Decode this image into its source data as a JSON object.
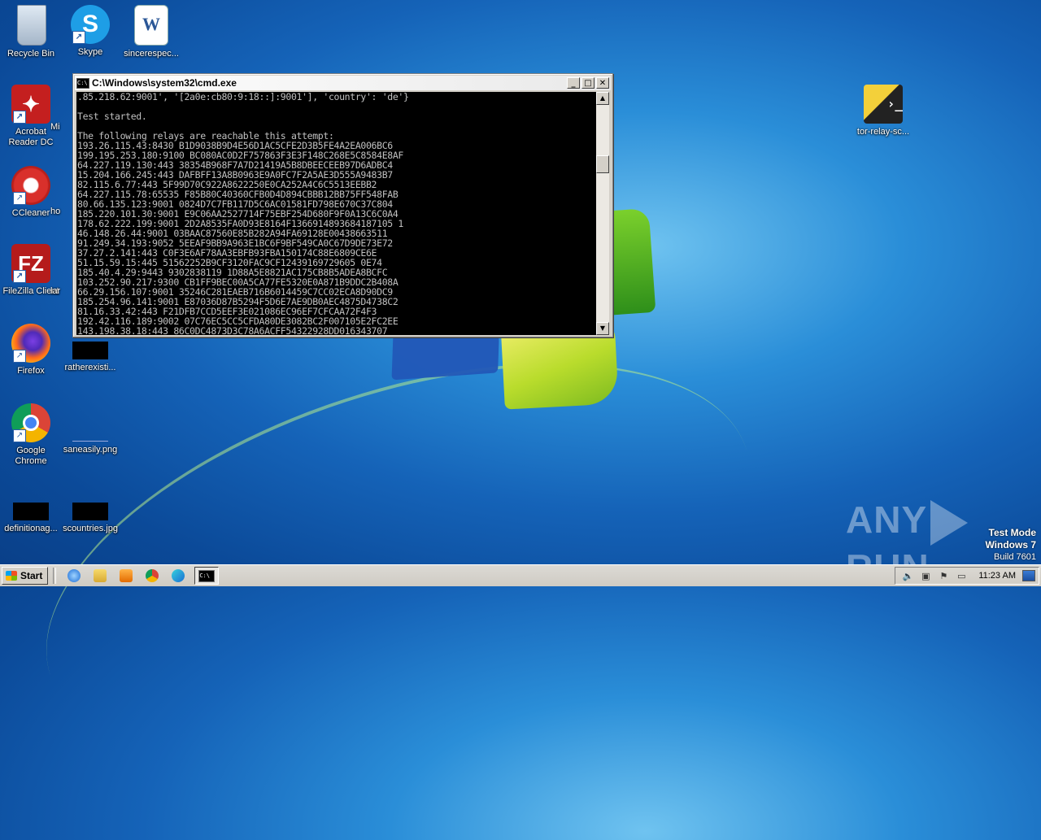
{
  "desktop": {
    "icons": [
      {
        "label": "Recycle Bin",
        "icon": "recycle-bin-icon"
      },
      {
        "label": "Skype",
        "icon": "skype-icon",
        "glyph": "S"
      },
      {
        "label": "sincerespec...",
        "icon": "word-document-icon",
        "glyph": "W"
      },
      {
        "label": "Acrobat Reader DC",
        "icon": "acrobat-icon"
      },
      {
        "label": "Mi",
        "icon": "partial-icon"
      },
      {
        "label": "CCleaner",
        "icon": "ccleaner-icon"
      },
      {
        "label": "ho",
        "icon": "partial-icon"
      },
      {
        "label": "FileZilla Client",
        "icon": "filezilla-icon",
        "glyph": "FZ"
      },
      {
        "label": "lar",
        "icon": "partial-icon"
      },
      {
        "label": "Firefox",
        "icon": "firefox-icon"
      },
      {
        "label": "ratherexisti...",
        "icon": "image-file-icon"
      },
      {
        "label": "Google Chrome",
        "icon": "chrome-icon"
      },
      {
        "label": "saneasily.png",
        "icon": "image-file-icon"
      },
      {
        "label": "definitionag...",
        "icon": "image-file-icon"
      },
      {
        "label": "scountries.jpg",
        "icon": "image-file-icon"
      },
      {
        "label": "tor-relay-sc...",
        "icon": "python-file-icon"
      }
    ]
  },
  "cmd_window": {
    "title": "C:\\Windows\\system32\\cmd.exe",
    "lines": [
      ".85.218.62:9001', '[2a0e:cb80:9:18::]:9001'], 'country': 'de'}",
      "",
      "Test started.",
      "",
      "The following relays are reachable this attempt:",
      "193.26.115.43:8430 B1D9038B9D4E56D1AC5CFE2D3B5FE4A2EA006BC6",
      "199.195.253.180:9100 BC080AC0D2F757863F3E3F148C268E5C8584E8AF",
      "64.227.119.130:443 38354B968F7A7D21419A5B8DBEECEEB97D6ADBC4",
      "15.204.166.245:443 DAFBFF13A8B0963E9A0FC7F2A5AE3D555A9483B7",
      "82.115.6.77:443 5F99D70C922A8622250E0CA252A4C6C5513EEBB2",
      "64.227.115.78:65535 F85B80C40360CFB0D4D894CBBB12BB75FF548FAB",
      "80.66.135.123:9001 0824D7C7FB117D5C6AC01581FD798E670C37C804",
      "185.220.101.30:9001 E9C06AA2527714F75EBF254D680F9F0A13C6C0A4",
      "178.62.222.199:9001 2D2A8535FA0D93E8164F1366914893684187105 1",
      "46.148.26.44:9001 03BAAC87560E85B282A94FA69128E00438663511",
      "91.249.34.193:9052 5EEAF9BB9A963E1BC6F9BF549CA0C67D9DE73E72",
      "37.27.2.141:443 C0F3E6AF78AA3EBFB93FBA150174C88E6809CE6E",
      "51.15.59.15:445 51562252B9CF3120FAC9CF12439169729605 0E74",
      "185.40.4.29:9443 9302838119 1D88A5E8821AC175CB8B5ADEA8BCFC",
      "103.252.90.217:9300 CB1FF9BEC00A5CA77FE5320E0A871B9DDC2B408A",
      "66.29.156.107:9001 35246C281EAEB716B6014459C7CC02ECA8D90DC9",
      "185.254.96.141:9001 E87036D87B5294F5D6E7AE9DB0AEC4875D4738C2",
      "81.16.33.42:443 F21DFB7CCD5EEF3E021086EC96EF7CFCAA72F4F3",
      "192.42.116.189:9002 07C76EC5CC5CFDA80DE3082BC2F007105E2FC2EE",
      "143.198.38.18:443 86C0DC4873D3C78A6ACFF54322928DD016343707"
    ]
  },
  "watermark": {
    "text_left": "ANY",
    "text_right": "RUN"
  },
  "test_mode": {
    "line1": "Test Mode",
    "line2": "Windows 7",
    "line3": "Build 7601"
  },
  "taskbar": {
    "start_label": "Start",
    "quick_launch": [
      "internet-explorer-icon",
      "explorer-icon",
      "media-player-icon",
      "chrome-icon",
      "edge-icon"
    ],
    "active_task": "cmd-task-icon",
    "clock": "11:23 AM"
  }
}
